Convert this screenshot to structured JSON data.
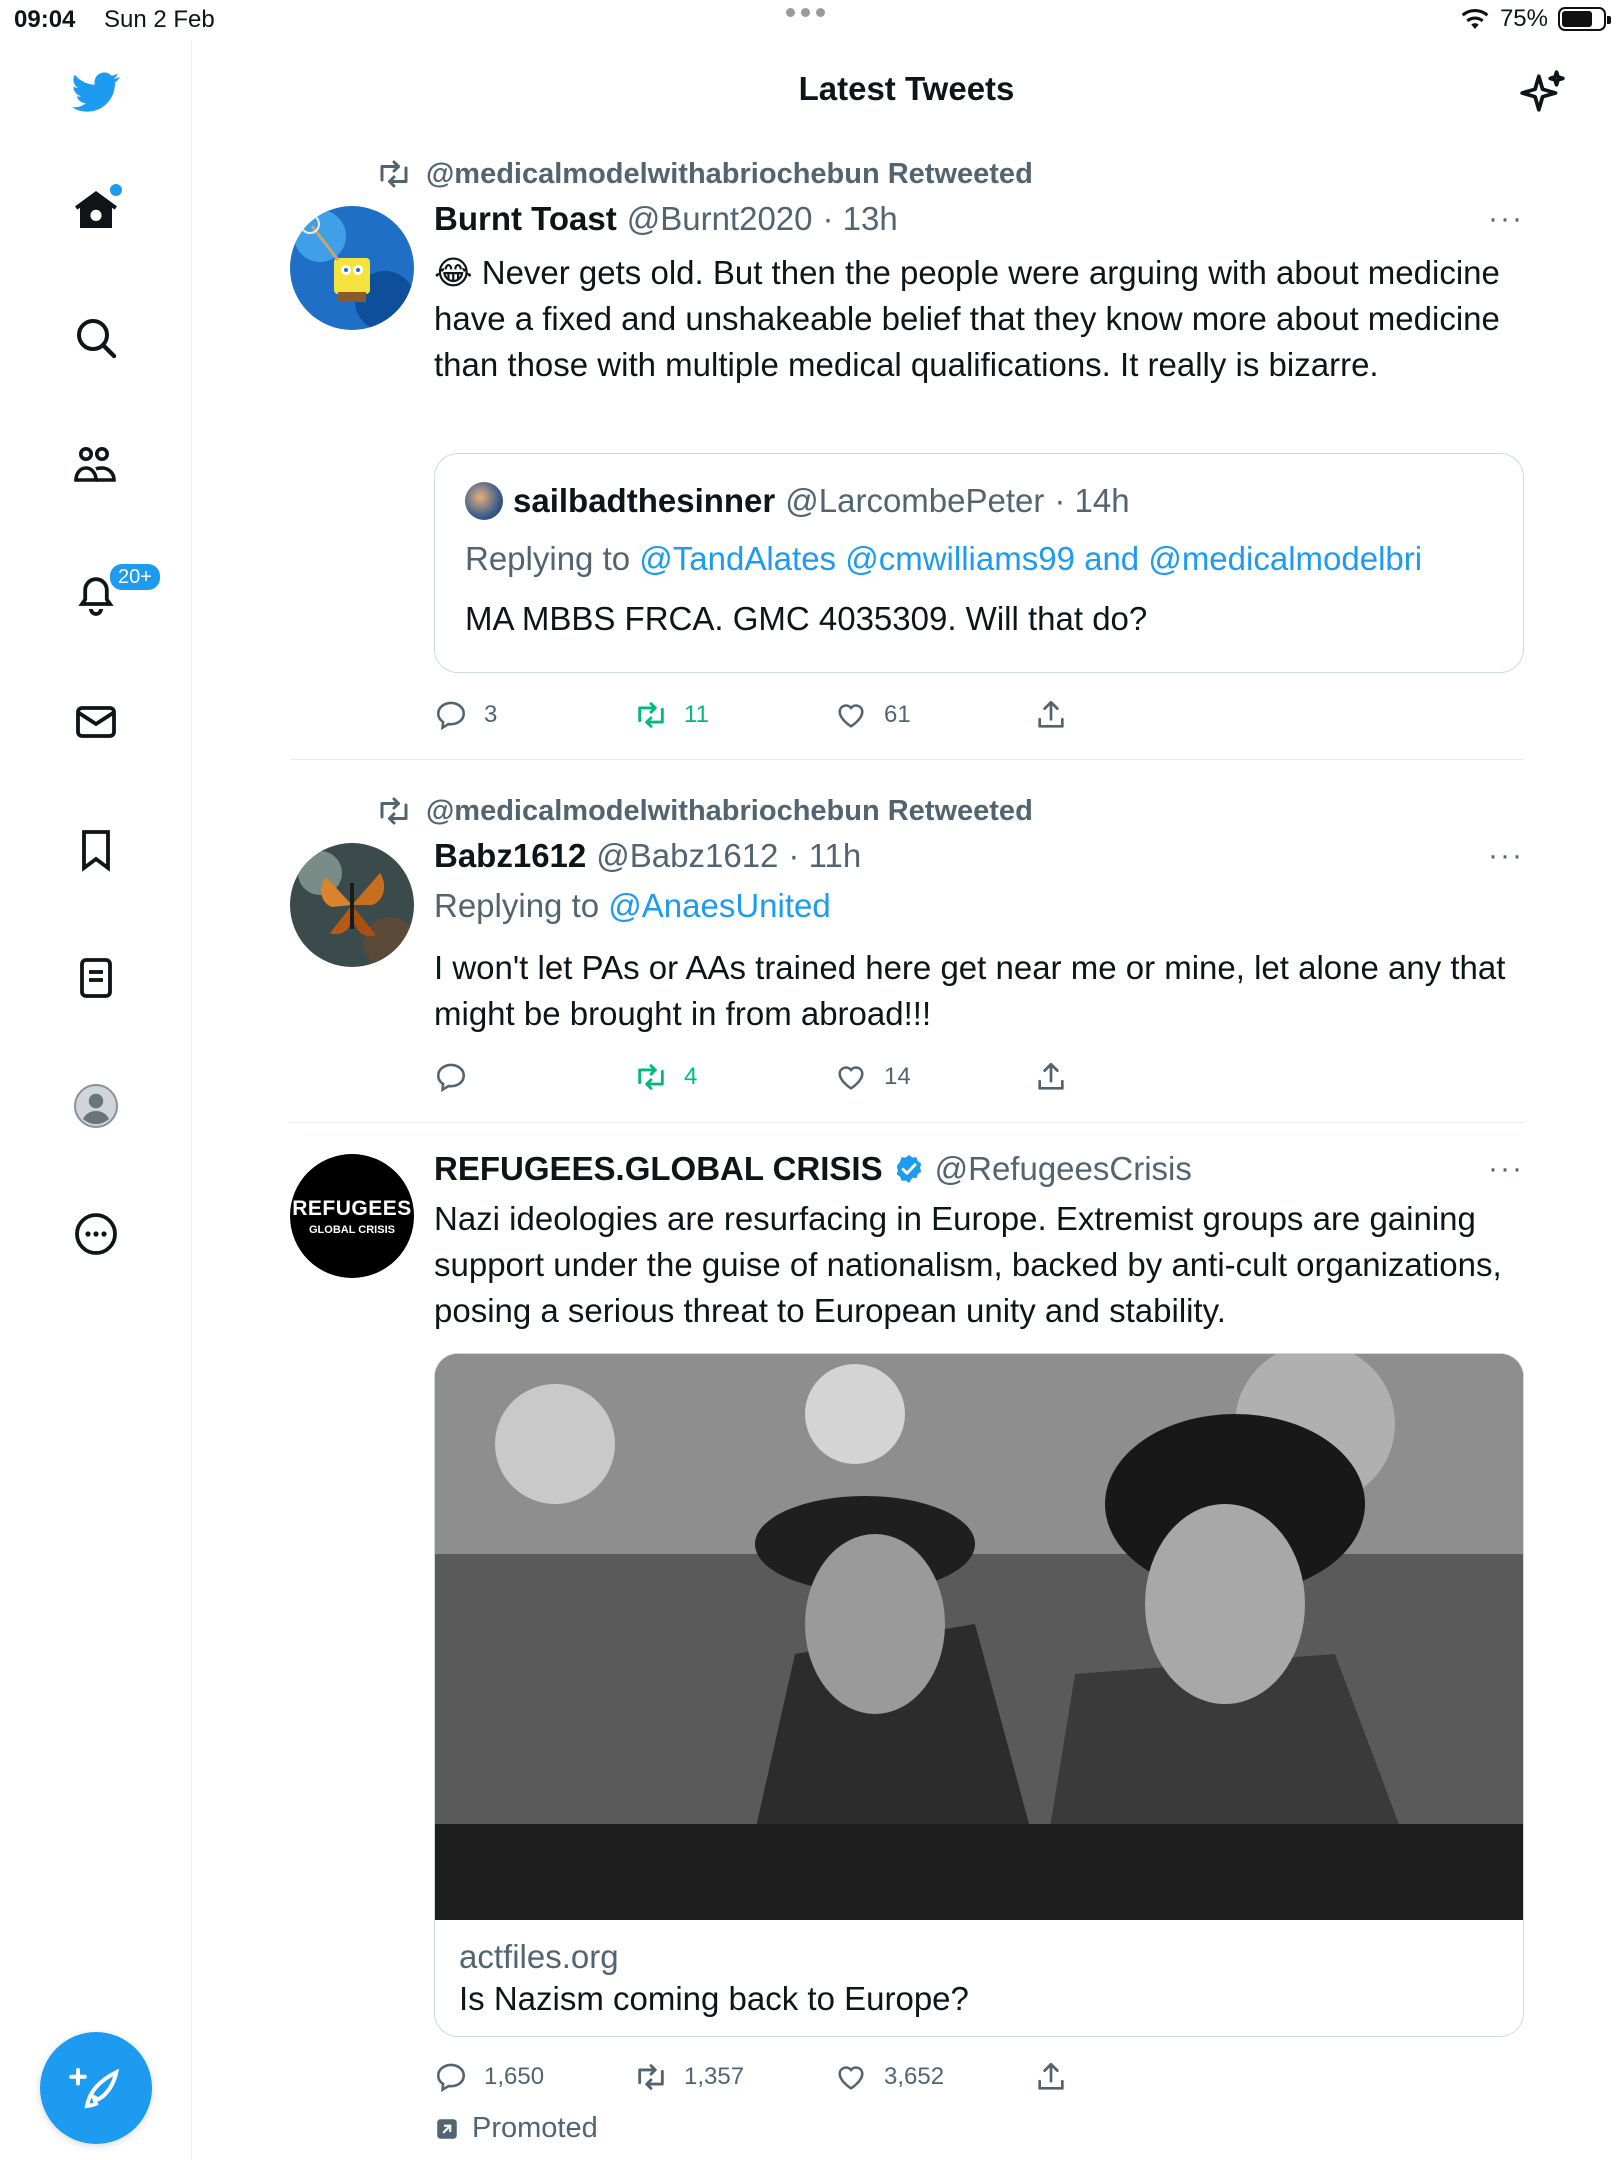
{
  "status_bar": {
    "time": "09:04",
    "date": "Sun 2 Feb",
    "battery": "75%",
    "battery_level": 0.75
  },
  "header": {
    "title": "Latest Tweets",
    "sparkle_icon": "sparkle-icon"
  },
  "sidebar": {
    "items": [
      {
        "icon": "twitter-bird-icon"
      },
      {
        "icon": "home-icon"
      },
      {
        "icon": "search-icon"
      },
      {
        "icon": "communities-icon"
      },
      {
        "icon": "bell-icon"
      },
      {
        "icon": "mail-icon"
      },
      {
        "icon": "bookmark-icon"
      },
      {
        "icon": "list-icon"
      },
      {
        "icon": "profile-icon"
      },
      {
        "icon": "more-icon"
      }
    ],
    "notification_badge": "20+",
    "compose_icon": "compose-icon"
  },
  "colors": {
    "accent": "#1d9bf0",
    "retweet": "#00ba7c",
    "muted": "#536471",
    "text": "#0f1419"
  },
  "tweets": [
    {
      "retweeted_by": "@medicalmodelwithabriochebun Retweeted",
      "name": "Burnt Toast",
      "handle": "@Burnt2020",
      "time": "· 13h",
      "emoji": "😂",
      "text": "Never gets old. But then the people were arguing with about medicine have a fixed and unshakeable belief that they know more about medicine than those with multiple medical qualifications. It really is bizarre.",
      "more": "···",
      "quote": {
        "name": "sailbadthesinner",
        "handle": "@LarcombePeter",
        "time": "· 14h",
        "replying_prefix": "Replying to",
        "replying_mentions": "@TandAlates @cmwilliams99 and @medicalmodelbri",
        "text": "MA MBBS FRCA. GMC 4035309. Will that do?"
      },
      "actions": {
        "replies": "3",
        "retweets": "11",
        "likes": "61"
      }
    },
    {
      "retweeted_by": "@medicalmodelwithabriochebun Retweeted",
      "name": "Babz1612",
      "handle": "@Babz1612",
      "time": "· 11h",
      "replying_prefix": "Replying to",
      "replying_mention": "@AnaesUnited",
      "text": "I won't let PAs or AAs trained here get near me or mine, let alone any that might be brought in from abroad!!!",
      "more": "···",
      "actions": {
        "replies": "",
        "retweets": "4",
        "likes": "14"
      }
    },
    {
      "name": "REFUGEES.GLOBAL CRISIS",
      "verified_icon": "verified-badge-icon",
      "handle": "@RefugeesCrisis",
      "avatar_line1": "REFUGEES",
      "avatar_line2": "GLOBAL CRISIS",
      "text": "Nazi ideologies are resurfacing in Europe. Extremist groups are gaining support under the guise of nationalism, backed by anti-cult organizations, posing a serious threat to European unity and stability.",
      "more": "···",
      "card": {
        "domain": "actfiles.org",
        "title": "Is Nazism coming back to Europe?"
      },
      "actions": {
        "replies": "1,650",
        "retweets": "1,357",
        "likes": "3,652"
      },
      "promoted": "Promoted"
    }
  ]
}
